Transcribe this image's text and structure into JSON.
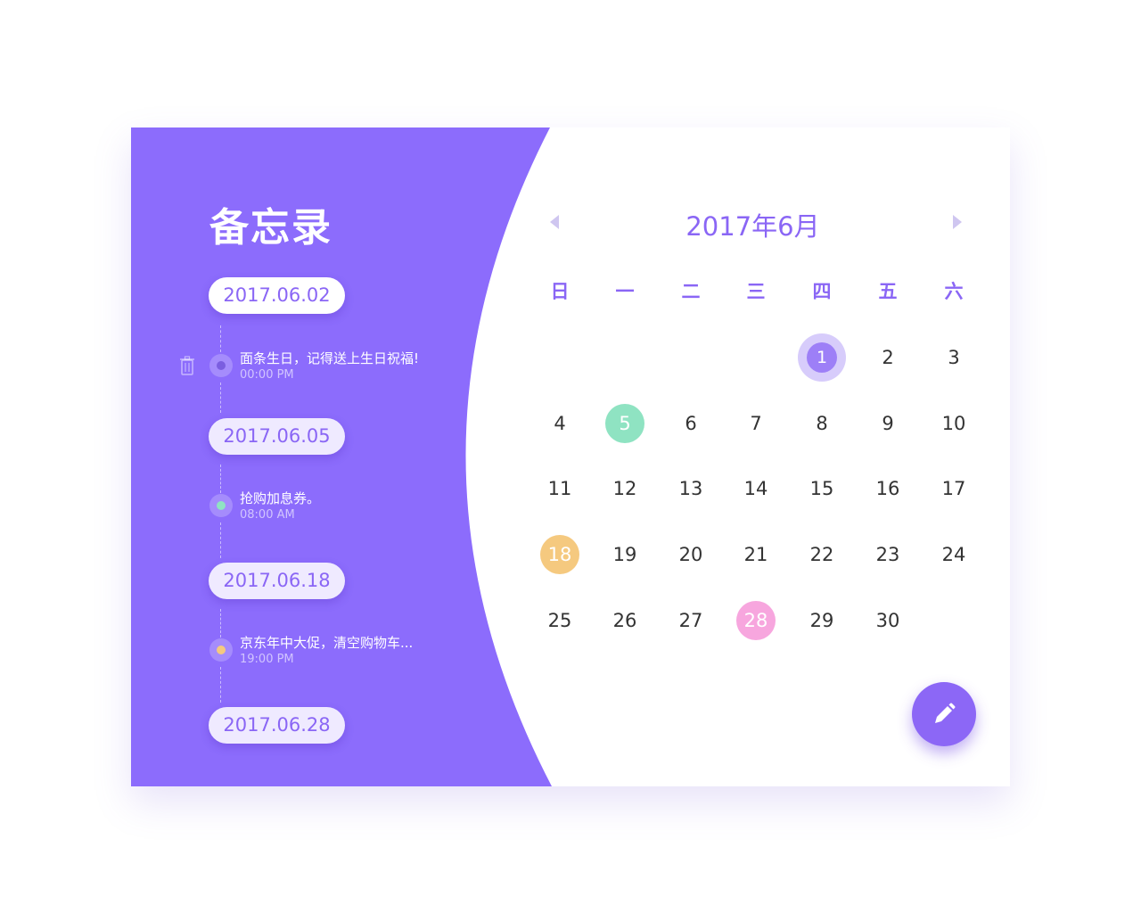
{
  "app": {
    "title": "备忘录"
  },
  "colors": {
    "primary": "#8c6cfc",
    "accent_text": "#8a66f5",
    "green": "#8fe3c2",
    "yellow": "#f5c97f",
    "pink": "#f7a6de",
    "today": "#9d7ff7",
    "today_ring": "#d7ccfb"
  },
  "memos": [
    {
      "date": "2017.06.02",
      "text": "面条生日，记得送上生日祝福!",
      "time": "00:00 PM",
      "dot_color": "#7b5ee0",
      "icon": "trash-icon"
    },
    {
      "date": "2017.06.05",
      "text": "抢购加息券。",
      "time": "08:00 AM",
      "dot_color": "#8fe3c2"
    },
    {
      "date": "2017.06.18",
      "text": "京东年中大促，清空购物车...",
      "time": "19:00 PM",
      "dot_color": "#f5c97f"
    },
    {
      "date": "2017.06.28"
    }
  ],
  "calendar": {
    "month_title": "2017年6月",
    "prev_icon": "triangle-left-icon",
    "next_icon": "triangle-right-icon",
    "weekdays": [
      "日",
      "一",
      "二",
      "三",
      "四",
      "五",
      "六"
    ],
    "weeks": [
      [
        "",
        "",
        "",
        "",
        "1",
        "2",
        "3"
      ],
      [
        "4",
        "5",
        "6",
        "7",
        "8",
        "9",
        "10"
      ],
      [
        "11",
        "12",
        "13",
        "14",
        "15",
        "16",
        "17"
      ],
      [
        "18",
        "19",
        "20",
        "21",
        "22",
        "23",
        "24"
      ],
      [
        "25",
        "26",
        "27",
        "28",
        "29",
        "30",
        ""
      ]
    ],
    "highlights": {
      "1": "#9d7ff7",
      "5": "#8fe3c2",
      "18": "#f5c97f",
      "28": "#f7a6de"
    },
    "today": "1"
  },
  "fab": {
    "icon": "pencil-icon"
  }
}
